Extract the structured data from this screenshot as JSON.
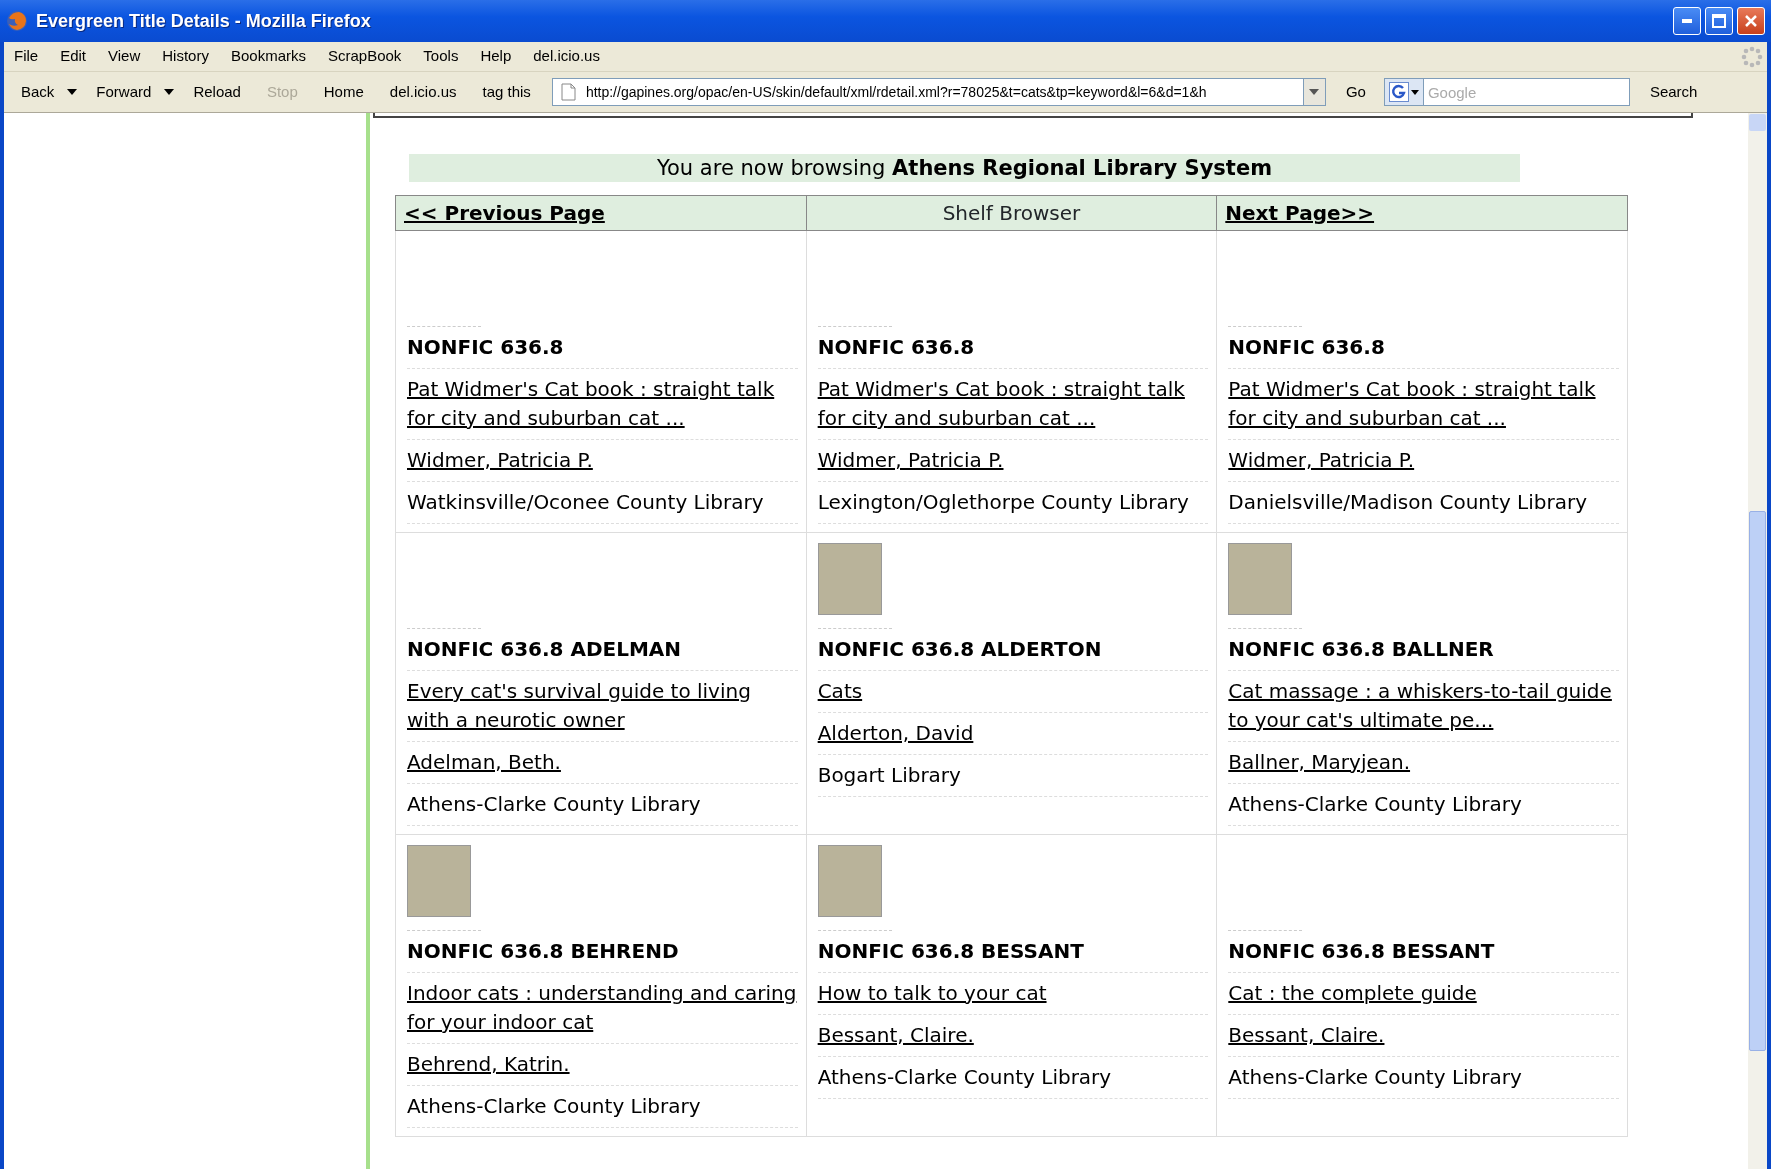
{
  "window": {
    "title": "Evergreen Title Details - Mozilla Firefox"
  },
  "menu": [
    "File",
    "Edit",
    "View",
    "History",
    "Bookmarks",
    "ScrapBook",
    "Tools",
    "Help",
    "del.icio.us"
  ],
  "toolbar": [
    {
      "label": "Back",
      "disabled": false,
      "dropdown": true
    },
    {
      "label": "Forward",
      "disabled": false,
      "dropdown": true
    },
    {
      "label": "Reload",
      "disabled": false,
      "dropdown": false
    },
    {
      "label": "Stop",
      "disabled": true,
      "dropdown": false
    },
    {
      "label": "Home",
      "disabled": false,
      "dropdown": false
    },
    {
      "label": "del.icio.us",
      "disabled": false,
      "dropdown": false
    },
    {
      "label": "tag this",
      "disabled": false,
      "dropdown": false
    }
  ],
  "address": {
    "value": "http://gapines.org/opac/en-US/skin/default/xml/rdetail.xml?r=78025&t=cats&tp=keyword&l=6&d=1&h"
  },
  "go_button": "Go",
  "search": {
    "placeholder": "Google",
    "button": "Search"
  },
  "banner": "You are now browsing **Athens Regional Library System**",
  "shelf_nav": {
    "previous": "<< Previous Page",
    "title": "Shelf Browser",
    "next": "Next Page>>"
  },
  "items": [
    {
      "cover": false,
      "call_number": "NONFIC 636.8",
      "title": "Pat Widmer's Cat book : straight talk for city and suburban cat ...",
      "author": "Widmer, Patricia P.",
      "library": "Watkinsville/Oconee County Library"
    },
    {
      "cover": false,
      "call_number": "NONFIC 636.8",
      "title": "Pat Widmer's Cat book : straight talk for city and suburban cat ...",
      "author": "Widmer, Patricia P.",
      "library": "Lexington/Oglethorpe County Library"
    },
    {
      "cover": false,
      "call_number": "NONFIC 636.8",
      "title": "Pat Widmer's Cat book : straight talk for city and suburban cat ...",
      "author": "Widmer, Patricia P.",
      "library": "Danielsville/Madison County Library"
    },
    {
      "cover": false,
      "call_number": "NONFIC 636.8 ADELMAN",
      "title": "Every cat's survival guide to living with a neurotic owner",
      "author": "Adelman, Beth.",
      "library": "Athens-Clarke County Library"
    },
    {
      "cover": true,
      "call_number": "NONFIC 636.8 ALDERTON",
      "title": "Cats",
      "author": "Alderton, David",
      "library": "Bogart Library"
    },
    {
      "cover": true,
      "call_number": "NONFIC 636.8 BALLNER",
      "title": "Cat massage : a whiskers-to-tail guide to your cat's ultimate pe...",
      "author": "Ballner, Maryjean.",
      "library": "Athens-Clarke County Library"
    },
    {
      "cover": true,
      "call_number": "NONFIC 636.8 BEHREND",
      "title": "Indoor cats : understanding and caring for your indoor cat",
      "author": "Behrend, Katrin.",
      "library": "Athens-Clarke County Library"
    },
    {
      "cover": true,
      "call_number": "NONFIC 636.8 BESSANT",
      "title": "How to talk to your cat",
      "author": "Bessant, Claire.",
      "library": "Athens-Clarke County Library"
    },
    {
      "cover": false,
      "call_number": "NONFIC 636.8 BESSANT",
      "title": "Cat : the complete guide",
      "author": "Bessant, Claire.",
      "library": "Athens-Clarke County Library"
    }
  ]
}
